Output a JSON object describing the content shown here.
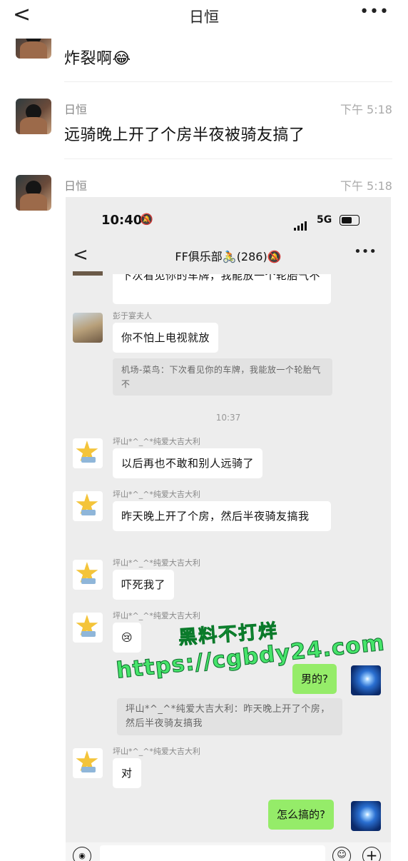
{
  "header": {
    "back": "<",
    "title": "日恒",
    "more": "•••"
  },
  "messages": [
    {
      "text": "炸裂啊😂"
    },
    {
      "nick": "日恒",
      "time": "下午 5:18",
      "text": "远骑晚上开了个房半夜被骑友搞了"
    },
    {
      "nick": "日恒",
      "time": "下午 5:18"
    }
  ],
  "screenshot": {
    "status": {
      "clock": "10:40",
      "bell": "🔕",
      "net": "5G"
    },
    "nav": {
      "back": "<",
      "title": "FF俱乐部🚴(286)🔕",
      "more": "•••"
    },
    "partial_bubble": "下次看见你的车牌，我能放一个轮胎气不",
    "msgs": [
      {
        "nick": "彭于宴夫人",
        "text": "你不怕上电视就放",
        "quote": "机场-菜鸟：下次看见你的车牌，我能放一个轮胎气不"
      },
      {
        "time": "10:37"
      },
      {
        "nick": "坪山*^_^*纯爱大吉大利",
        "text": "以后再也不敢和别人远骑了"
      },
      {
        "nick": "坪山*^_^*纯爱大吉大利",
        "text": "昨天晚上开了个房，然后半夜骑友搞我"
      },
      {
        "nick": "坪山*^_^*纯爱大吉大利",
        "text": "吓死我了"
      },
      {
        "nick": "坪山*^_^*纯爱大吉大利",
        "text": "😢"
      },
      {
        "self": "男的?"
      },
      {
        "quote": "坪山*^_^*纯爱大吉大利：昨天晚上开了个房，然后半夜骑友搞我"
      },
      {
        "nick": "坪山*^_^*纯爱大吉大利",
        "text": "对"
      },
      {
        "self": "怎么搞的?"
      }
    ],
    "watermark": {
      "line1": "黑料不打烊",
      "line2": "https://cgbdy24.com"
    },
    "input": {
      "voice": "◉",
      "emoji": "☺",
      "plus": "+"
    }
  }
}
